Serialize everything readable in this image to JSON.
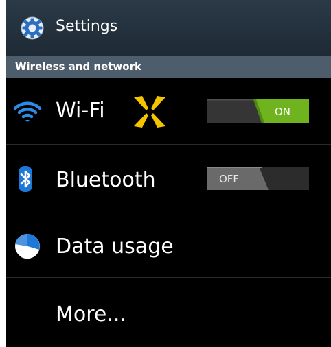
{
  "header": {
    "title": "Settings",
    "icon": "gear-icon"
  },
  "section": {
    "title": "Wireless and network"
  },
  "items": [
    {
      "label": "Wi-Fi",
      "icon": "wifi-icon",
      "toggle": "ON"
    },
    {
      "label": "Bluetooth",
      "icon": "bluetooth-icon",
      "toggle": "OFF"
    },
    {
      "label": "Data usage",
      "icon": "pie-chart-icon"
    },
    {
      "label": "More..."
    }
  ],
  "colors": {
    "toggle_on": "#6fb31e",
    "header_bg": "#233240",
    "section_bg": "#4e5d6b",
    "accent_blue": "#2a8ce6",
    "spark_yellow": "#f5c400"
  }
}
